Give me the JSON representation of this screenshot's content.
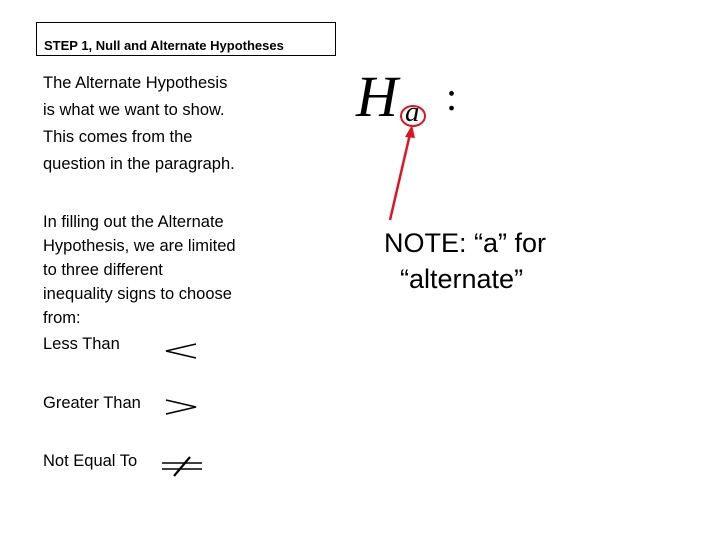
{
  "title": "STEP 1, Null and Alternate Hypotheses",
  "intro_lines": [
    "The Alternate Hypothesis",
    "is what we want to show.",
    "This comes from the",
    "question in the paragraph."
  ],
  "filling_lines": [
    "In filling out the Alternate",
    "Hypothesis, we are limited",
    "to three different",
    "inequality signs to choose",
    "from:"
  ],
  "signs": [
    {
      "label": "Less Than",
      "symbol": "less-than"
    },
    {
      "label": "Greater Than",
      "symbol": "greater-than"
    },
    {
      "label": "Not Equal To",
      "symbol": "not-equal"
    }
  ],
  "formula": {
    "main": "H",
    "subscript": "a",
    "suffix": ":"
  },
  "note": {
    "line1": "NOTE:  “a” for",
    "line2": "“alternate”"
  },
  "colors": {
    "annotation": "#e0141e"
  }
}
